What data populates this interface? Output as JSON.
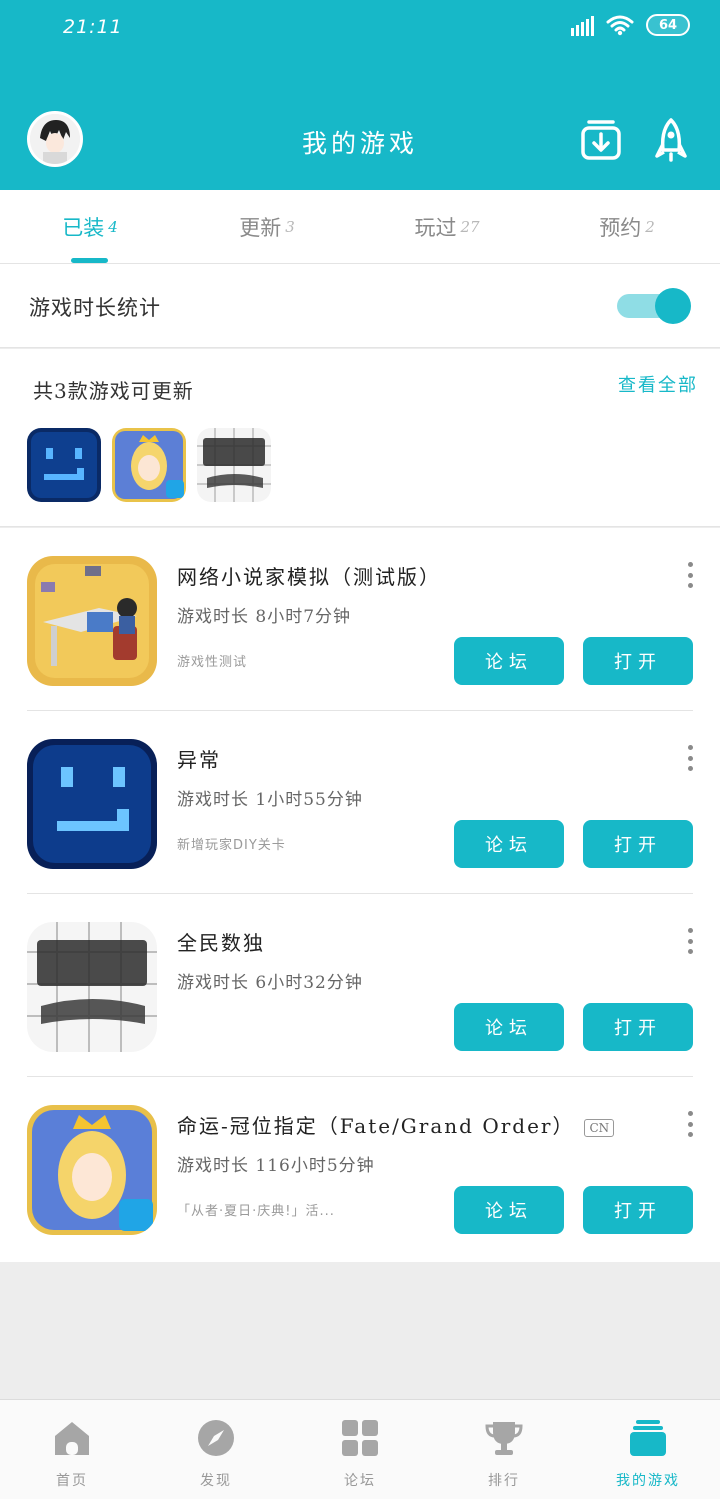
{
  "status_bar": {
    "time": "21:11",
    "battery": "64"
  },
  "header": {
    "title": "我的游戏"
  },
  "tabs": [
    {
      "label": "已装",
      "count": "4"
    },
    {
      "label": "更新",
      "count": "3"
    },
    {
      "label": "玩过",
      "count": "27"
    },
    {
      "label": "预约",
      "count": "2"
    }
  ],
  "playtime_toggle": {
    "label": "游戏时长统计",
    "enabled": true
  },
  "updates": {
    "title": "共3款游戏可更新",
    "view_all": "查看全部"
  },
  "games": [
    {
      "name": "网络小说家模拟（测试版）",
      "playtime": "游戏时长 8小时7分钟",
      "desc": "游戏性测试",
      "badge": ""
    },
    {
      "name": "异常",
      "playtime": "游戏时长 1小时55分钟",
      "desc": "新增玩家DIY关卡",
      "badge": ""
    },
    {
      "name": "全民数独",
      "playtime": "游戏时长 6小时32分钟",
      "desc": "",
      "badge": ""
    },
    {
      "name": "命运-冠位指定（Fate/Grand Order）",
      "playtime": "游戏时长 116小时5分钟",
      "desc": "「从者·夏日·庆典!」活...",
      "badge": "CN"
    }
  ],
  "buttons": {
    "forum": "论坛",
    "open": "打开"
  },
  "bottom_nav": [
    {
      "label": "首页"
    },
    {
      "label": "发现"
    },
    {
      "label": "论坛"
    },
    {
      "label": "排行"
    },
    {
      "label": "我的游戏"
    }
  ],
  "colors": {
    "accent": "#17b8c8",
    "accent_light": "#8fdde5"
  }
}
